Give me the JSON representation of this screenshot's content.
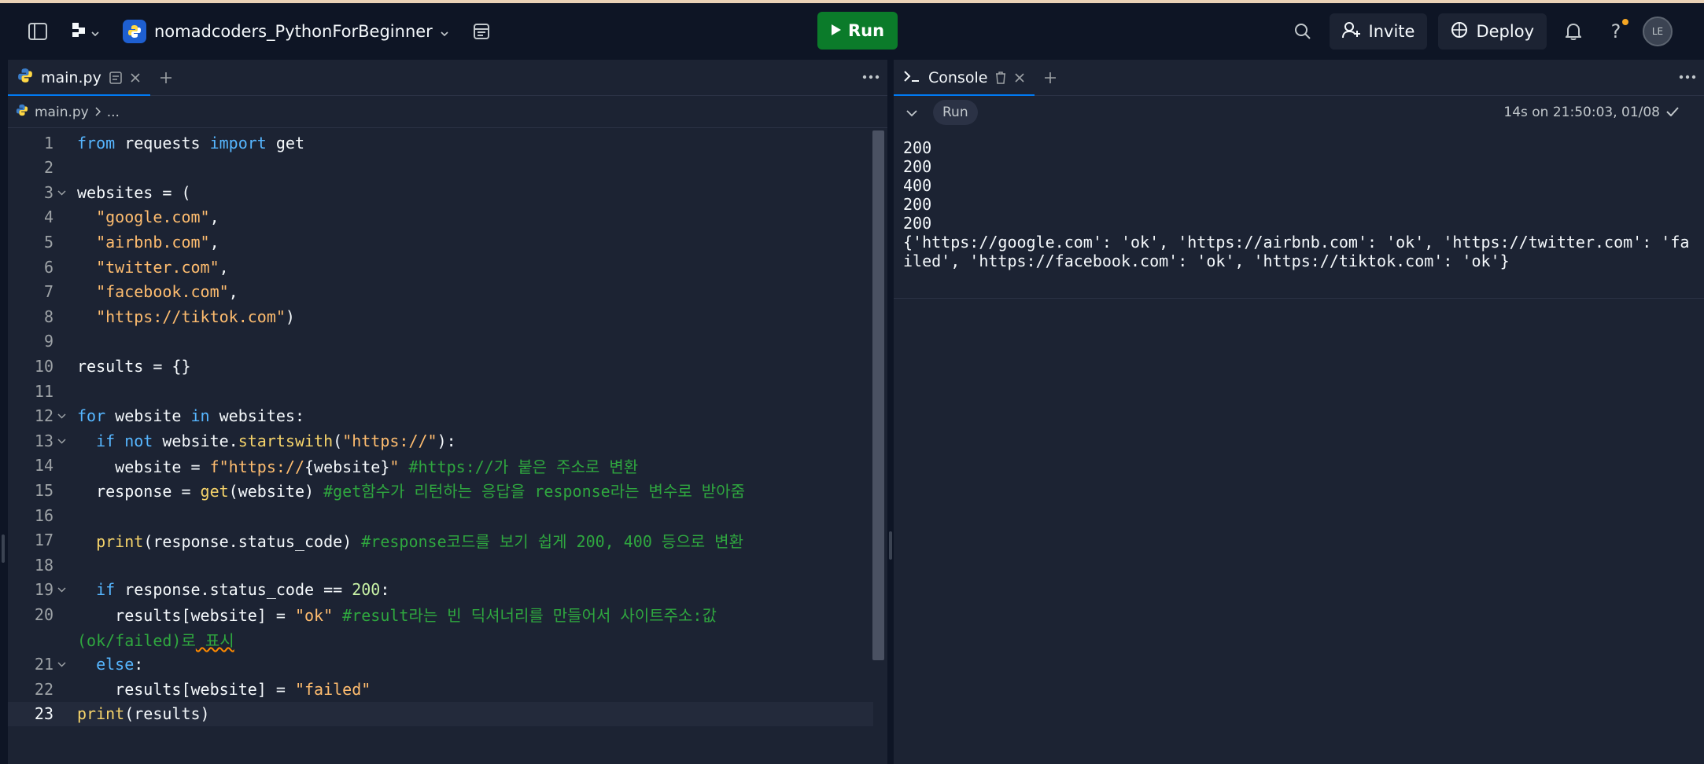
{
  "header": {
    "project_name": "nomadcoders_PythonForBeginner",
    "run_label": "Run",
    "invite_label": "Invite",
    "deploy_label": "Deploy",
    "avatar_initials": "LE",
    "help_label": "?"
  },
  "editor": {
    "tab_label": "main.py",
    "breadcrumb_file": "main.py",
    "breadcrumb_more": "...",
    "active_line": 23,
    "lines": [
      {
        "n": "1",
        "fold": false
      },
      {
        "n": "2",
        "fold": false
      },
      {
        "n": "3",
        "fold": true
      },
      {
        "n": "4",
        "fold": false
      },
      {
        "n": "5",
        "fold": false
      },
      {
        "n": "6",
        "fold": false
      },
      {
        "n": "7",
        "fold": false
      },
      {
        "n": "8",
        "fold": false
      },
      {
        "n": "9",
        "fold": false
      },
      {
        "n": "10",
        "fold": false
      },
      {
        "n": "11",
        "fold": false
      },
      {
        "n": "12",
        "fold": true
      },
      {
        "n": "13",
        "fold": true
      },
      {
        "n": "14",
        "fold": false
      },
      {
        "n": "15",
        "fold": false
      },
      {
        "n": "16",
        "fold": false
      },
      {
        "n": "17",
        "fold": false
      },
      {
        "n": "18",
        "fold": false
      },
      {
        "n": "19",
        "fold": true
      },
      {
        "n": "20",
        "fold": false
      },
      {
        "n": "",
        "fold": false
      },
      {
        "n": "21",
        "fold": true
      },
      {
        "n": "22",
        "fold": false
      },
      {
        "n": "23",
        "fold": false
      }
    ],
    "code": [
      [
        {
          "t": "from",
          "c": "kw"
        },
        {
          "t": " requests "
        },
        {
          "t": "import",
          "c": "kw"
        },
        {
          "t": " get"
        }
      ],
      [],
      [
        {
          "t": "websites = ("
        }
      ],
      [
        {
          "t": "  "
        },
        {
          "t": "\"google.com\"",
          "c": "str"
        },
        {
          "t": ","
        }
      ],
      [
        {
          "t": "  "
        },
        {
          "t": "\"airbnb.com\"",
          "c": "str"
        },
        {
          "t": ","
        }
      ],
      [
        {
          "t": "  "
        },
        {
          "t": "\"twitter.com\"",
          "c": "str"
        },
        {
          "t": ","
        }
      ],
      [
        {
          "t": "  "
        },
        {
          "t": "\"facebook.com\"",
          "c": "str"
        },
        {
          "t": ","
        }
      ],
      [
        {
          "t": "  "
        },
        {
          "t": "\"https://tiktok.com\"",
          "c": "str"
        },
        {
          "t": ")"
        }
      ],
      [],
      [
        {
          "t": "results = {}"
        }
      ],
      [],
      [
        {
          "t": "for",
          "c": "kw"
        },
        {
          "t": " website "
        },
        {
          "t": "in",
          "c": "kw"
        },
        {
          "t": " websites:"
        }
      ],
      [
        {
          "t": "  "
        },
        {
          "t": "if not",
          "c": "kw"
        },
        {
          "t": " website."
        },
        {
          "t": "startswith",
          "c": "fn"
        },
        {
          "t": "("
        },
        {
          "t": "\"https://\"",
          "c": "str"
        },
        {
          "t": "):"
        }
      ],
      [
        {
          "t": "    website = "
        },
        {
          "t": "f\"https://",
          "c": "str"
        },
        {
          "t": "{website}"
        },
        {
          "t": "\"",
          "c": "str"
        },
        {
          "t": " "
        },
        {
          "t": "#https://가 붙은 주소로 변환",
          "c": "cm"
        }
      ],
      [
        {
          "t": "  response = "
        },
        {
          "t": "get",
          "c": "fn"
        },
        {
          "t": "(website) "
        },
        {
          "t": "#get함수가 리턴하는 응답을 response라는 변수로 받아줌",
          "c": "cm"
        }
      ],
      [],
      [
        {
          "t": "  "
        },
        {
          "t": "print",
          "c": "fn"
        },
        {
          "t": "(response.status_code) "
        },
        {
          "t": "#response코드를 보기 쉽게 200, 400 등으로 변환",
          "c": "cm"
        }
      ],
      [],
      [
        {
          "t": "  "
        },
        {
          "t": "if",
          "c": "kw"
        },
        {
          "t": " response.status_code == "
        },
        {
          "t": "200",
          "c": "num"
        },
        {
          "t": ":"
        }
      ],
      [
        {
          "t": "    results[website] = "
        },
        {
          "t": "\"ok\"",
          "c": "str"
        },
        {
          "t": " "
        },
        {
          "t": "#result라는 빈 딕셔너리를 만들어서 사이트주소:값",
          "c": "cm"
        }
      ],
      [
        {
          "t": "(ok/failed)로",
          "c": "cm"
        },
        {
          "t": " 표시",
          "c": "cm wave"
        }
      ],
      [
        {
          "t": "  "
        },
        {
          "t": "else",
          "c": "kw"
        },
        {
          "t": ":"
        }
      ],
      [
        {
          "t": "    results[website] = "
        },
        {
          "t": "\"failed\"",
          "c": "str"
        }
      ],
      [
        {
          "t": "print",
          "c": "fn"
        },
        {
          "t": "(results)"
        }
      ]
    ]
  },
  "console": {
    "tab_label": "Console",
    "run_chip": "Run",
    "status": "14s on 21:50:03, 01/08",
    "output": "200\n200\n400\n200\n200\n{'https://google.com': 'ok', 'https://airbnb.com': 'ok', 'https://twitter.com': 'failed', 'https://facebook.com': 'ok', 'https://tiktok.com': 'ok'}"
  },
  "icons": [
    "sidebar-toggle-icon",
    "workspace-icon",
    "project-logo-icon",
    "files-icon",
    "search-icon",
    "invite-icon",
    "deploy-icon",
    "bell-icon",
    "help-icon",
    "python-icon",
    "close-icon",
    "plus-icon",
    "more-icon",
    "console-icon",
    "trash-icon",
    "chevron-down-icon",
    "check-icon",
    "play-icon"
  ]
}
